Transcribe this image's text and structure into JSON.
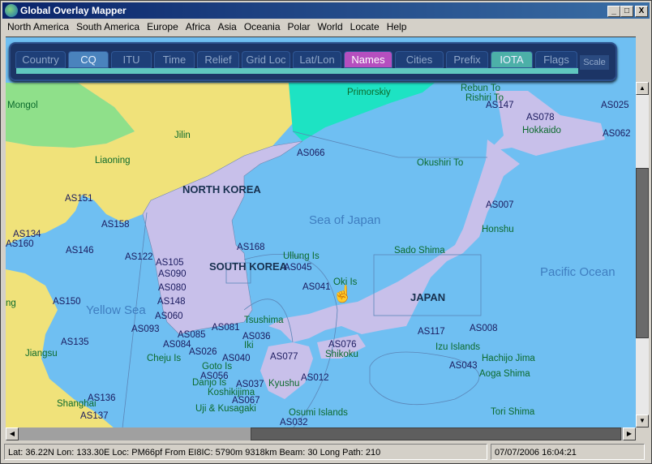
{
  "window": {
    "title": "Global Overlay Mapper",
    "minimize": "_",
    "maximize": "□",
    "close": "X"
  },
  "menu": [
    "North America",
    "South America",
    "Europe",
    "Africa",
    "Asia",
    "Oceania",
    "Polar",
    "World",
    "Locate",
    "Help"
  ],
  "toolbar": {
    "tabs": [
      "Country",
      "CQ",
      "ITU",
      "Time",
      "Relief",
      "Grid Loc",
      "Lat/Lon",
      "Names",
      "Cities",
      "Prefix",
      "IOTA",
      "Flags"
    ],
    "active_tabs": [
      "CQ",
      "Names",
      "IOTA"
    ],
    "scale": "Scale",
    "colors": {
      "panel": "#1c3566",
      "cq": "#4a83bd",
      "names": "#b54fbf",
      "iota": "#4cb0a8"
    }
  },
  "map": {
    "colors": {
      "sea": "#6fbff2",
      "china": "#f0e27a",
      "mongolia": "#8fe08a",
      "russia": "#1de3c3",
      "korea_japan": "#c8c0ea"
    },
    "labels": [
      "Mongol",
      "Primorskiy",
      "Rebun To",
      "Rishiri To",
      "AS147",
      "AS078",
      "AS025",
      "Hokkaido",
      "AS062",
      "Jilin",
      "AS066",
      "Liaoning",
      "Okushiri To",
      "NORTH KOREA",
      "AS151",
      "AS007",
      "Sea of Japan",
      "AS158",
      "AS134",
      "Honshu",
      "AS160",
      "AS146",
      "AS168",
      "Sado Shima",
      "Ullung Is",
      "AS122",
      "SOUTH KOREA",
      "AS105",
      "AS045",
      "Pacific Ocean",
      "AS090",
      "Oki Is",
      "AS041",
      "AS080",
      "JAPAN",
      "AS150",
      "ng",
      "AS148",
      "Yellow Sea",
      "AS060",
      "Tsushima",
      "AS081",
      "AS093",
      "AS117",
      "AS008",
      "AS085",
      "AS036",
      "AS135",
      "AS084",
      "Iki",
      "AS076",
      "Izu Islands",
      "AS026",
      "Shikoku",
      "Jiangsu",
      "Cheju Is",
      "AS040",
      "AS077",
      "Hachijo Jima",
      "Goto Is",
      "AS043",
      "AS056",
      "AS012",
      "Aoga Shima",
      "Danjo Is",
      "AS037",
      "Kyushu",
      "Koshikijima",
      "AS136",
      "AS067",
      "Shanghai",
      "Uji & Kusagaki",
      "AS137",
      "Osumi Islands",
      "Tori Shima",
      "AS032"
    ],
    "cursor_icon": "hand-pointer-icon"
  },
  "status": {
    "info": "Lat: 36.22N  Lon: 133.30E  Loc: PM66pf  From EI8IC: 5790m  9318km  Beam: 30  Long Path: 210",
    "datetime": "07/07/2006 16:04:21"
  }
}
